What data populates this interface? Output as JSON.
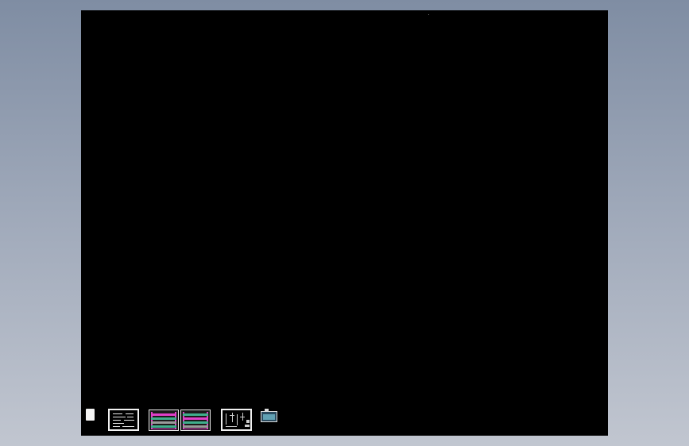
{
  "colors": {
    "background_top": "#7f8da3",
    "background_bottom": "#c1c6d0",
    "canvas": "#000000",
    "sheet_border": "#f2f2f2",
    "accent_magenta": "#e040c8",
    "accent_cyan": "#6fb6c8",
    "accent_green": "#3fae8c"
  },
  "canvas": {
    "icon": "black-drawing-canvas"
  },
  "thumbnails": [
    {
      "icon": "page-icon"
    },
    {
      "icon": "text-sheet-icon"
    },
    {
      "icon": "colored-plan-sheet-icon"
    },
    {
      "icon": "colored-plan-sheet-icon"
    },
    {
      "icon": "framed-drawing-sheet-icon"
    },
    {
      "icon": "small-sheet-icon"
    }
  ]
}
